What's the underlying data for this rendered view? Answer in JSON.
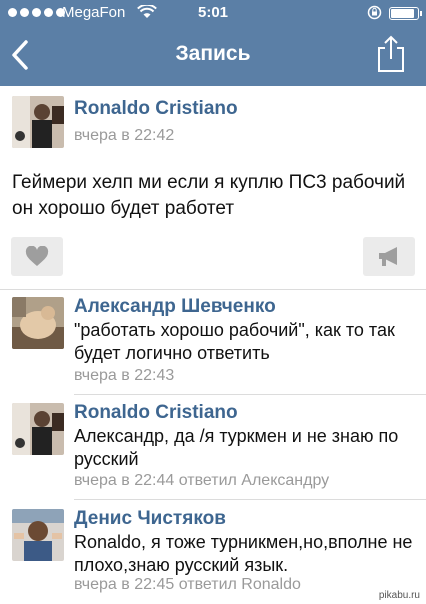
{
  "status": {
    "carrier": "MegaFon",
    "time": "5:01",
    "battery_level": 0.9
  },
  "nav": {
    "title": "Запись"
  },
  "post": {
    "author": "Ronaldo Cristiano",
    "time": "вчера в 22:42",
    "text": "Геймери хелп ми если я куплю ПС3 рабочий он хорошо будет работет"
  },
  "comments": [
    {
      "author": "Александр Шевченко",
      "text": "\"работать хорошо рабочий\", как то так будет логично ответить",
      "meta": "вчера в 22:43"
    },
    {
      "author": "Ronaldo Cristiano",
      "text": "Александр, да /я туркмен и не знаю по русский",
      "meta": "вчера в 22:44 ответил Александру"
    },
    {
      "author": "Денис Чистяков",
      "text": "Ronaldo, я тоже турникмен,но,вполне не плохо,знаю русский язык.",
      "meta": "вчера в 22:45 ответил Ronaldo"
    }
  ],
  "watermark": "pikabu.ru",
  "colors": {
    "navbar": "#5b7fa6",
    "author_link": "#3e6690",
    "meta_gray": "#9a9a9a",
    "button_bg": "#ebebeb"
  },
  "icons": [
    "back-chevron-icon",
    "share-icon",
    "heart-icon",
    "megaphone-icon",
    "wifi-icon",
    "rotation-lock-icon",
    "battery-icon"
  ]
}
